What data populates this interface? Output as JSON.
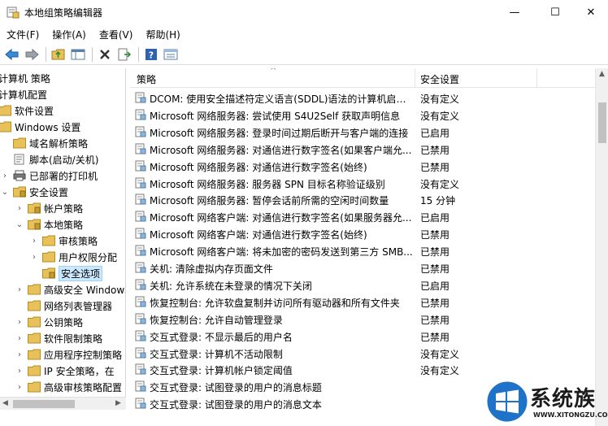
{
  "window": {
    "title": "本地组策略编辑器",
    "minimize_glyph": "—",
    "maximize_glyph": "☐",
    "close_glyph": "✕"
  },
  "menu": [
    "文件(F)",
    "操作(A)",
    "查看(V)",
    "帮助(H)"
  ],
  "toolbar_icons": [
    "back-arrow-icon",
    "forward-arrow-icon",
    "up-folder-icon",
    "show-hide-tree-icon",
    "delete-icon",
    "export-list-icon",
    "help-icon",
    "properties-icon"
  ],
  "tree": [
    {
      "label": "计算机 策略",
      "level": 0,
      "chevron": "",
      "folder": false
    },
    {
      "label": "计算机配置",
      "level": 0,
      "chevron": "",
      "folder": false
    },
    {
      "label": "软件设置",
      "level": 0,
      "chevron": "",
      "folder": true
    },
    {
      "label": "Windows 设置",
      "level": 0,
      "chevron": "",
      "folder": true
    },
    {
      "label": "域名解析策略",
      "level": 1,
      "chevron": "",
      "folder": true
    },
    {
      "label": "脚本(启动/关机)",
      "level": 1,
      "chevron": "",
      "folder": false
    },
    {
      "label": "已部署的打印机",
      "level": 1,
      "chevron": "›",
      "folder": false
    },
    {
      "label": "安全设置",
      "level": 1,
      "chevron": "⌄",
      "folder": true
    },
    {
      "label": "帐户策略",
      "level": 2,
      "chevron": "›",
      "folder": true
    },
    {
      "label": "本地策略",
      "level": 2,
      "chevron": "⌄",
      "folder": true
    },
    {
      "label": "审核策略",
      "level": 3,
      "chevron": "›",
      "folder": true
    },
    {
      "label": "用户权限分配",
      "level": 3,
      "chevron": "›",
      "folder": true
    },
    {
      "label": "安全选项",
      "level": 3,
      "chevron": "",
      "folder": true,
      "selected": true
    },
    {
      "label": "高级安全 Windows",
      "level": 2,
      "chevron": "›",
      "folder": true
    },
    {
      "label": "网络列表管理器",
      "level": 2,
      "chevron": "",
      "folder": true
    },
    {
      "label": "公钥策略",
      "level": 2,
      "chevron": "›",
      "folder": true
    },
    {
      "label": "软件限制策略",
      "level": 2,
      "chevron": "›",
      "folder": true
    },
    {
      "label": "应用程序控制策略",
      "level": 2,
      "chevron": "›",
      "folder": true
    },
    {
      "label": "IP 安全策略，在",
      "level": 2,
      "chevron": "›",
      "folder": true
    },
    {
      "label": "高级审核策略配置",
      "level": 2,
      "chevron": "›",
      "folder": true
    }
  ],
  "list": {
    "col_policy": "策略",
    "col_setting": "安全设置",
    "sort_glyph": "^",
    "rows": [
      {
        "name": "DCOM: 使用安全描述符定义语言(SDDL)语法的计算机启动...",
        "value": "没有定义"
      },
      {
        "name": "Microsoft 网络服务器: 尝试使用 S4U2Self 获取声明信息",
        "value": "没有定义"
      },
      {
        "name": "Microsoft 网络服务器: 登录时间过期后断开与客户端的连接",
        "value": "已启用"
      },
      {
        "name": "Microsoft 网络服务器: 对通信进行数字签名(如果客户端允...",
        "value": "已禁用"
      },
      {
        "name": "Microsoft 网络服务器: 对通信进行数字签名(始终)",
        "value": "已禁用"
      },
      {
        "name": "Microsoft 网络服务器: 服务器 SPN 目标名称验证级别",
        "value": "没有定义"
      },
      {
        "name": "Microsoft 网络服务器: 暂停会话前所需的空闲时间数量",
        "value": "15 分钟"
      },
      {
        "name": "Microsoft 网络客户端: 对通信进行数字签名(如果服务器允...",
        "value": "已启用"
      },
      {
        "name": "Microsoft 网络客户端: 对通信进行数字签名(始终)",
        "value": "已禁用"
      },
      {
        "name": "Microsoft 网络客户端: 将未加密的密码发送到第三方 SMB...",
        "value": "已禁用"
      },
      {
        "name": "关机: 清除虚拟内存页面文件",
        "value": "已禁用"
      },
      {
        "name": "关机: 允许系统在未登录的情况下关闭",
        "value": "已启用"
      },
      {
        "name": "恢复控制台: 允许软盘复制并访问所有驱动器和所有文件夹",
        "value": "已禁用"
      },
      {
        "name": "恢复控制台: 允许自动管理登录",
        "value": "已禁用"
      },
      {
        "name": "交互式登录: 不显示最后的用户名",
        "value": "已禁用"
      },
      {
        "name": "交互式登录: 计算机不活动限制",
        "value": "没有定义"
      },
      {
        "name": "交互式登录: 计算机帐户锁定阈值",
        "value": "没有定义"
      },
      {
        "name": "交互式登录: 试图登录的用户的消息标题",
        "value": ""
      },
      {
        "name": "交互式登录: 试图登录的用户的消息文本",
        "value": ""
      }
    ]
  },
  "watermark": {
    "brand": "系统族",
    "url": "WWW.XITONGZU.COM"
  },
  "colors": {
    "selection_bg": "#cce8ff",
    "folder_yellow": "#e8c15a",
    "accent_blue": "#1e73c8"
  }
}
